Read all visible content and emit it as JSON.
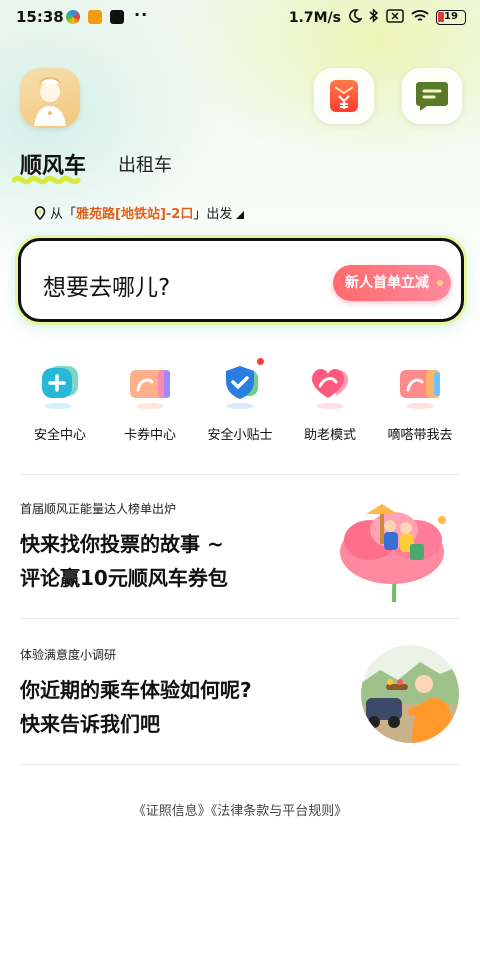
{
  "status_bar": {
    "time": "15:38",
    "network_speed": "1.7M/s",
    "battery": "19"
  },
  "header": {
    "coupon_icon": "yen-coupon-icon",
    "message_icon": "chat-message-icon"
  },
  "tabs": [
    {
      "label": "顺风车",
      "active": true
    },
    {
      "label": "出租车",
      "active": false
    }
  ],
  "departure": {
    "prefix": "从「",
    "location": "雅苑路[地铁站]-2口",
    "suffix": "」出发"
  },
  "destination": {
    "placeholder": "想要去哪儿?",
    "promo_label": "新人首单立减"
  },
  "quick_actions": [
    {
      "label": "安全中心",
      "icon": "shield-plus-icon"
    },
    {
      "label": "卡券中心",
      "icon": "coupon-card-icon"
    },
    {
      "label": "安全小贴士",
      "icon": "shield-check-icon",
      "badge": true
    },
    {
      "label": "助老模式",
      "icon": "heart-elder-icon"
    },
    {
      "label": "嘀嗒带我去",
      "icon": "car-guide-icon"
    }
  ],
  "cards": [
    {
      "subtitle": "首届顺风正能量达人榜单出炉",
      "title_line1": "快来找你投票的故事 ~",
      "title_line2": "评论赢10元顺风车券包"
    },
    {
      "subtitle": "体验满意度小调研",
      "title_line1": "你近期的乘车体验如何呢?",
      "title_line2": "快来告诉我们吧"
    }
  ],
  "footer": {
    "license_link": "《证照信息》",
    "rules_link": "《法律条款与平台规则》"
  },
  "colors": {
    "accent_orange": "#e0611a",
    "promo_red": "#ff6a6a",
    "tab_underline": "#d6ea3a"
  }
}
